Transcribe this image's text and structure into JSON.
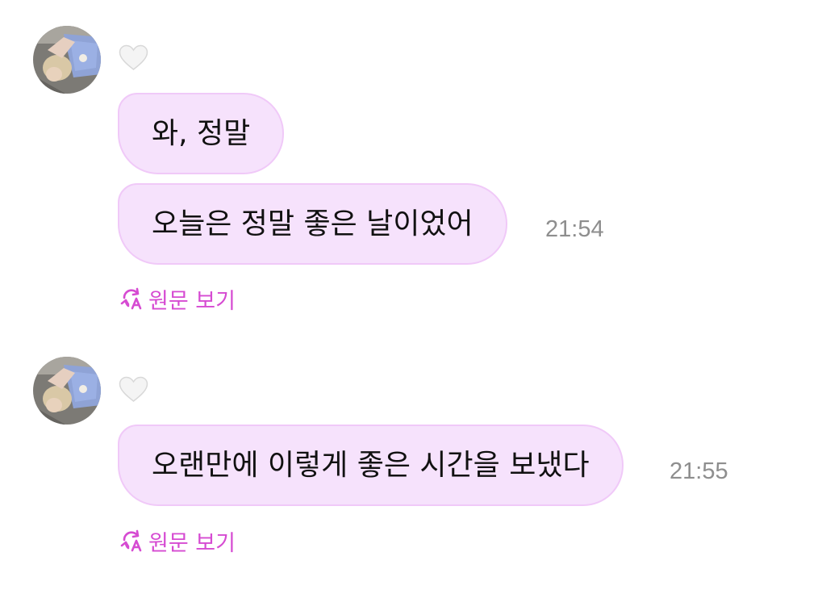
{
  "chat": {
    "groups": [
      {
        "avatar": "user-avatar",
        "reaction": "white-heart-icon",
        "messages": [
          {
            "text": "와, 정말",
            "time": ""
          },
          {
            "text": "오늘은 정말 좋은 날이었어",
            "time": "21:54"
          }
        ],
        "see_original": "원문 보기"
      },
      {
        "avatar": "user-avatar",
        "reaction": "white-heart-icon",
        "messages": [
          {
            "text": "오랜만에 이렇게 좋은 시간을 보냈다",
            "time": "21:55"
          }
        ],
        "see_original": "원문 보기"
      }
    ]
  },
  "icons": {
    "translate": "translate-icon",
    "heart": "white-heart-icon"
  },
  "colors": {
    "bubble_fill": "#f6e2fc",
    "bubble_border": "#f0c9f8",
    "link": "#d64bd2",
    "timestamp": "#8e8e8e",
    "heart": "#ececec"
  }
}
